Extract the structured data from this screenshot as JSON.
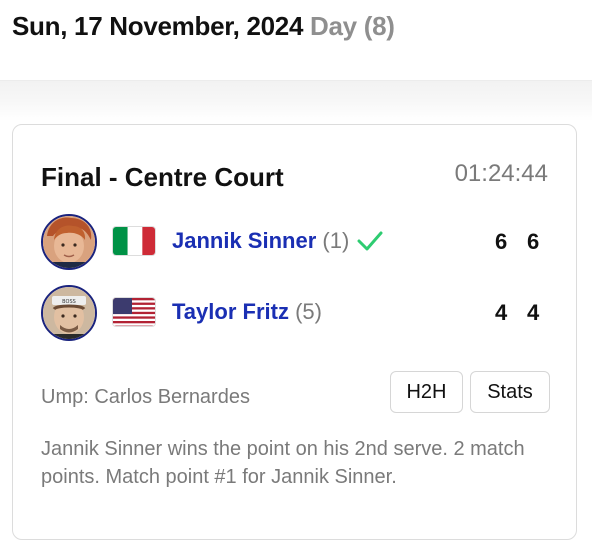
{
  "header": {
    "date": "Sun, 17 November, 2024",
    "day": "Day (8)"
  },
  "match": {
    "round": "Final - Centre Court",
    "duration": "01:24:44",
    "players": [
      {
        "name": "Jannik Sinner",
        "seed": "(1)",
        "country": "Italy",
        "winner": true,
        "sets": [
          "6",
          "6"
        ]
      },
      {
        "name": "Taylor Fritz",
        "seed": "(5)",
        "country": "USA",
        "winner": false,
        "sets": [
          "4",
          "4"
        ]
      }
    ],
    "umpire": "Ump: Carlos Bernardes",
    "buttons": {
      "h2h": "H2H",
      "stats": "Stats"
    },
    "commentary": "Jannik Sinner wins the point on his 2nd serve. 2 match points. Match point #1 for Jannik Sinner."
  },
  "colors": {
    "player_name": "#1a2fb3",
    "winner_check": "#2ecc71",
    "muted": "#7a7a7a",
    "avatar_border": "#1a237e"
  },
  "icons": [
    "winner-check-icon",
    "flag-italy-icon",
    "flag-usa-icon"
  ]
}
